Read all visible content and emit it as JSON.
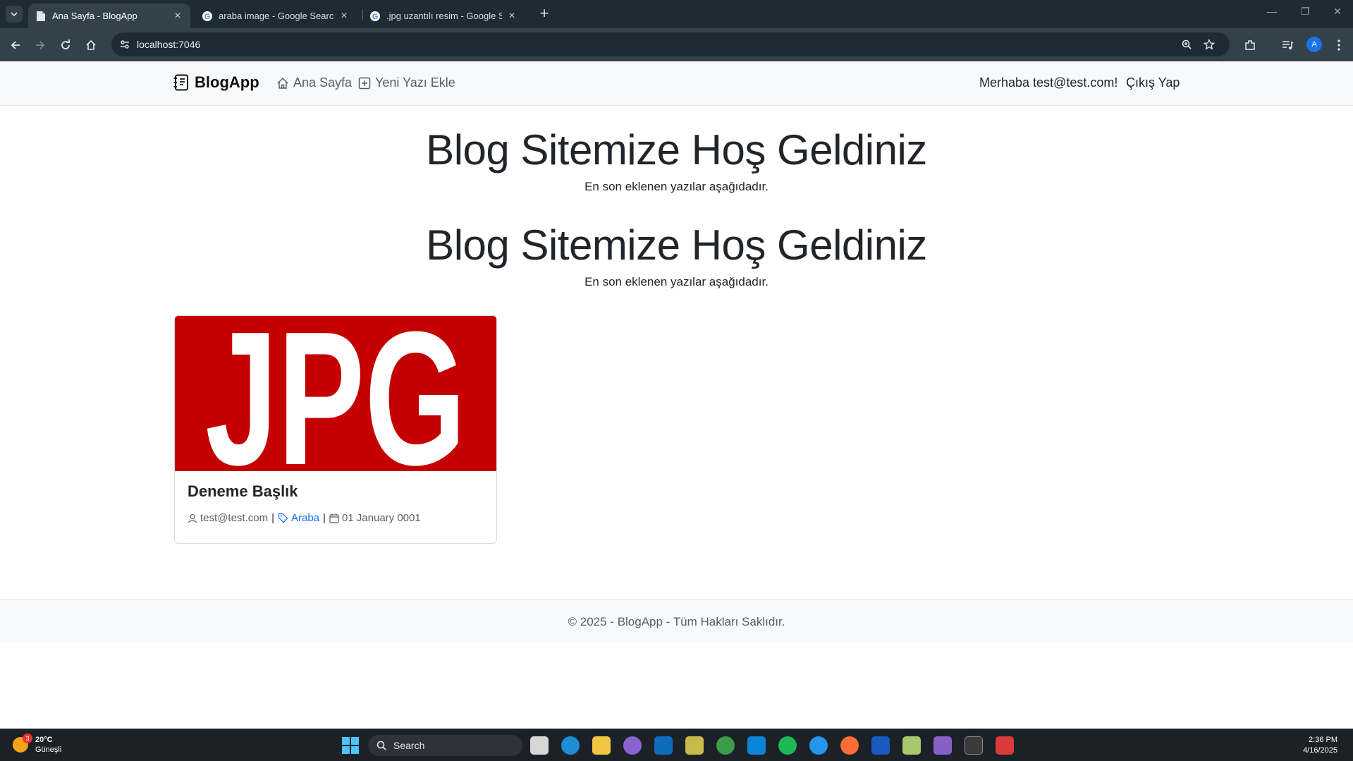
{
  "browser": {
    "tabs": [
      {
        "title": "Ana Sayfa - BlogApp",
        "active": true
      },
      {
        "title": "araba image - Google Search",
        "active": false
      },
      {
        "title": ".jpg uzantılı resim - Google Search",
        "active": false
      }
    ],
    "new_tab": "+",
    "url": "localhost:7046",
    "profile_initial": "A"
  },
  "site": {
    "brand": "BlogApp",
    "nav": {
      "home": "Ana Sayfa",
      "new_post": "Yeni Yazı Ekle"
    },
    "greeting": "Merhaba test@test.com!",
    "logout": "Çıkış Yap"
  },
  "hero": [
    {
      "title": "Blog Sitemize Hoş Geldiniz",
      "subtitle": "En son eklenen yazılar aşağıdadır."
    },
    {
      "title": "Blog Sitemize Hoş Geldiniz",
      "subtitle": "En son eklenen yazılar aşağıdadır."
    }
  ],
  "post": {
    "image_text": "JPG",
    "title": "Deneme Başlık",
    "author": "test@test.com",
    "category": "Araba",
    "date": "01 January 0001",
    "separator": "|"
  },
  "footer": {
    "text": "© 2025 - BlogApp - Tüm Hakları Saklıdır."
  },
  "taskbar": {
    "weather_temp": "20°C",
    "weather_desc": "Güneşli",
    "weather_badge": "3",
    "search": "Search",
    "time": "2:36 PM",
    "date": "4/16/2025"
  },
  "colors": {
    "accent": "#0d6efd",
    "image_bg": "#c40000",
    "nav_bg": "#f8f9fa",
    "chrome_dark": "#1f2b32"
  }
}
